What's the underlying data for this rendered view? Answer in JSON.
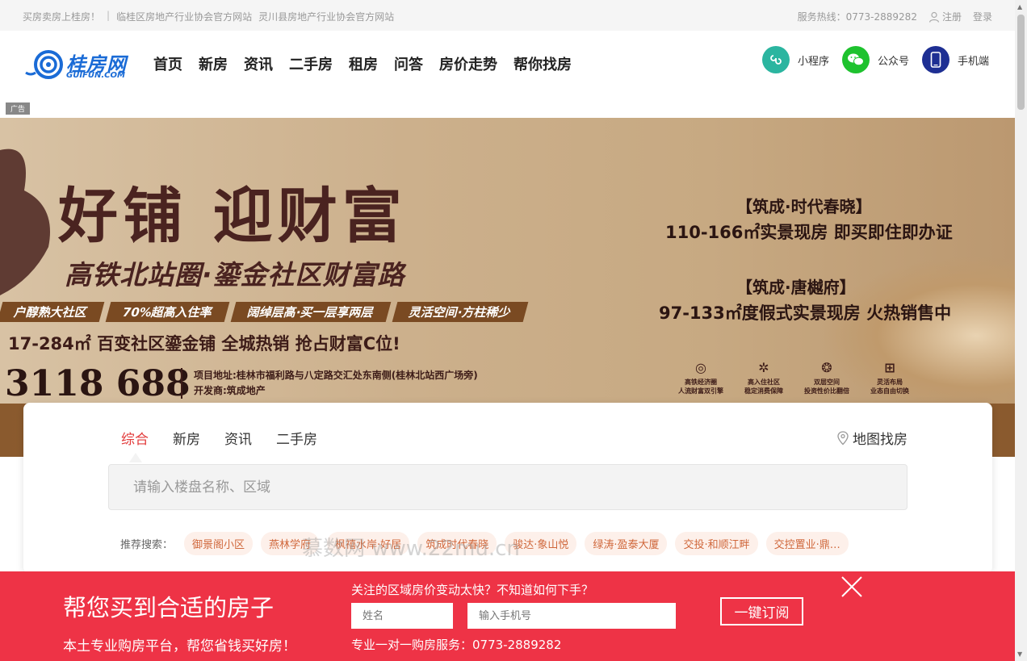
{
  "topbar": {
    "left_links": [
      "买房卖房上桂房！",
      "临桂区房地产行业协会官方网站",
      "灵川县房地产行业协会官方网站"
    ],
    "hotline": "服务热线：0773-2889282",
    "register": "注册",
    "login": "登录"
  },
  "header": {
    "logo_cn": "桂房网",
    "logo_en": "GUIFUN.COM",
    "nav": [
      "首页",
      "新房",
      "资讯",
      "二手房",
      "租房",
      "问答",
      "房价走势",
      "帮你找房"
    ],
    "tools": [
      {
        "label": "小程序",
        "icon": "mini-program-icon",
        "color": "#2bb5a0"
      },
      {
        "label": "公众号",
        "icon": "wechat-icon",
        "color": "#1ec22e"
      },
      {
        "label": "手机端",
        "icon": "mobile-icon",
        "color": "#1e2f93"
      }
    ]
  },
  "ad_label": "广告",
  "banner": {
    "title": "好铺 迎财富",
    "subtitle": "高铁北站圈·鎏金社区财富路",
    "tags": [
      "户醇熟大社区",
      "70%超高入住率",
      "阔绰层高·买一层享两层",
      "灵活空间·方柱稀少"
    ],
    "line": "17-284㎡ 百变社区鎏金铺 全城热销 抢占财富C位!",
    "phone": "3118 688",
    "address": "项目地址:桂林市福利路与八定路交汇处东南侧(桂林北站西广场旁)",
    "developer": "开发商:筑成地产",
    "right_1": "【筑成·时代春晓】",
    "right_2": "110-166㎡实景现房 即买即住即办证",
    "right_3": "【筑成·唐樾府】",
    "right_4": "97-133㎡度假式实景现房 火热销售中",
    "icons": [
      {
        "glyph": "◎",
        "title": "高铁经济圈",
        "note": "人流财富双引擎"
      },
      {
        "glyph": "✲",
        "title": "高入住社区",
        "note": "稳定消费保障"
      },
      {
        "glyph": "❂",
        "title": "双层空间",
        "note": "投资性价比翻倍"
      },
      {
        "glyph": "⊞",
        "title": "灵活布局",
        "note": "业态自由切换"
      }
    ],
    "accent": "#4a2320"
  },
  "search": {
    "tabs": [
      "综合",
      "新房",
      "资讯",
      "二手房"
    ],
    "active_tab": "综合",
    "map_find": "地图找房",
    "placeholder": "请输入楼盘名称、区域",
    "hot_label": "推荐搜索：",
    "hot_tags": [
      "御景阁小区",
      "燕林学府",
      "枫禧水岸·好居",
      "筑成时代春晓",
      "骏达·象山悦",
      "绿涛·盈泰大厦",
      "交投·和顺江畔",
      "交控置业·鼎…"
    ],
    "watermark": "慕数网 www.22mu.cn"
  },
  "promo": {
    "title": "帮您买到合适的房子",
    "subtitle": "本土专业购房平台，帮您省钱买好房！",
    "question": "关注的区域房价变动太快？不知道如何下手？",
    "name_placeholder": "姓名",
    "phone_placeholder": "输入手机号",
    "service": "专业一对一购房服务：0773-2889282",
    "subscribe": "一键订阅",
    "bg_color": "#ee3346"
  }
}
